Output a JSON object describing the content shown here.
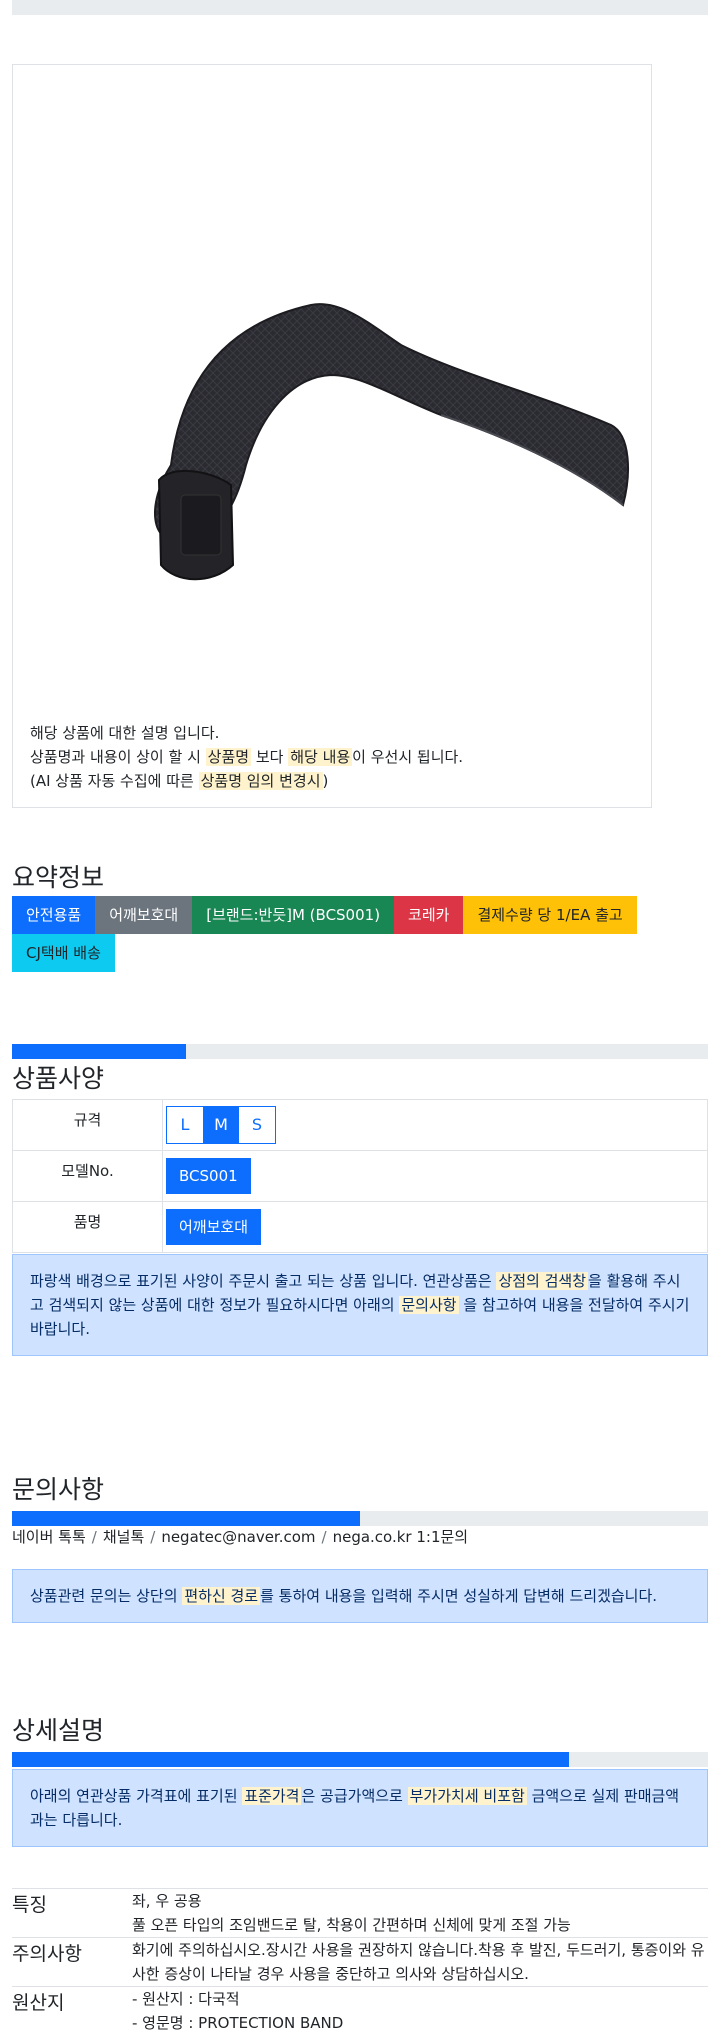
{
  "product": {
    "image_alt": "어깨보호대 제품 이미지",
    "desc_line1": "해당 상품에 대한 설명 입니다.",
    "desc_line2_a": "상품명과 내용이 상이 할 시 ",
    "desc_line2_hl1": "상품명",
    "desc_line2_b": " 보다 ",
    "desc_line2_hl2": "해당 내용",
    "desc_line2_c": "이 우선시 됩니다.",
    "desc_line3_a": "(AI 상품 자동 수집에 따른 ",
    "desc_line3_hl": "상품명 임의 변경시",
    "desc_line3_b": ")"
  },
  "summary": {
    "title": "요약정보",
    "badges": [
      {
        "label": "안전용품",
        "color": "#0d6efd"
      },
      {
        "label": "어깨보호대",
        "color": "#6c757d"
      },
      {
        "label": "[브랜드:반듯]M (BCS001)",
        "color": "#198754"
      },
      {
        "label": "코레카",
        "color": "#dc3545"
      },
      {
        "label": "결제수량 당 1/EA 출고",
        "color": "#ffc107"
      },
      {
        "label": "CJ택배 배송",
        "color": "#0dcaf0"
      }
    ]
  },
  "spec": {
    "title": "상품사양",
    "progress_fraction": 0.25,
    "rows": {
      "size_label": "규격",
      "size_options": [
        "L",
        "M",
        "S"
      ],
      "size_selected": "M",
      "model_label": "모델No.",
      "model_value": "BCS001",
      "name_label": "품명",
      "name_value": "어깨보호대"
    },
    "notice_a": "파랑색 배경으로 표기된 사양이 주문시 출고 되는 상품 입니다. 연관상품은 ",
    "notice_hl1": "상점의 검색창",
    "notice_b": "을 활용해 주시고 검색되지 않는 상품에 대한 정보가 필요하시다면 아래의 ",
    "notice_hl2": "문의사항",
    "notice_c": " 을 참고하여 내용을 전달하여 주시기 바랍니다."
  },
  "inquiry": {
    "title": "문의사항",
    "progress_fraction": 0.5,
    "links": [
      "네이버 톡톡",
      "채널톡",
      "negatec@naver.com",
      "nega.co.kr 1:1문의"
    ],
    "separator": "/",
    "notice_a": "상품관련 문의는 상단의 ",
    "notice_hl": "편하신 경로",
    "notice_b": "를 통하여 내용을 입력해 주시면 성실하게 답변해 드리겠습니다."
  },
  "detail": {
    "title": "상세설명",
    "progress_fraction": 0.8,
    "notice_a": "아래의 연관상품 가격표에 표기된 ",
    "notice_hl1": "표준가격",
    "notice_b": "은 공급가액으로 ",
    "notice_hl2": "부가가치세 비포함",
    "notice_c": " 금액으로 실제 판매금액과는 다릅니다.",
    "features": [
      {
        "key": "특징",
        "lines": [
          "좌, 우 공용",
          "풀 오픈 타입의 조임밴드로 탈, 착용이 간편하며 신체에 맞게 조절 가능"
        ]
      },
      {
        "key": "주의사항",
        "lines": [
          "화기에 주의하십시오.장시간 사용을 권장하지 않습니다.착용 후 발진, 두드러기, 통증이와 유사한 증상이 나타날 경우 사용을 중단하고 의사와 상담하십시오."
        ]
      },
      {
        "key": "원산지",
        "lines": [
          "- 원산지 : 다국적",
          "- 영문명 : PROTECTION BAND"
        ]
      }
    ]
  }
}
